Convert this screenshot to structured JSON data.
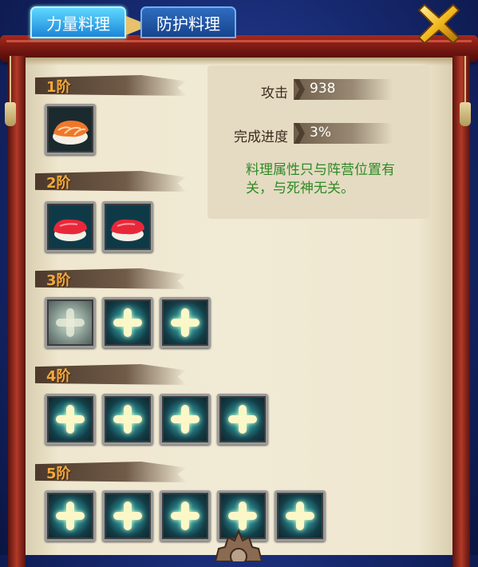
{
  "tabs": [
    {
      "label": "力量料理",
      "active": true
    },
    {
      "label": "防护料理",
      "active": false
    }
  ],
  "info": {
    "attack_label": "攻击",
    "attack_value": "938",
    "progress_label": "完成进度",
    "progress_value": "3%",
    "note": "料理属性只与阵营位置有关，与死神无关。"
  },
  "tiers": [
    {
      "label": "1阶",
      "slots": [
        "salmon-sushi"
      ]
    },
    {
      "label": "2阶",
      "slots": [
        "tuna-sushi",
        "tuna-sushi"
      ]
    },
    {
      "label": "3阶",
      "slots": [
        "add-selected",
        "add",
        "add"
      ]
    },
    {
      "label": "4阶",
      "slots": [
        "add",
        "add",
        "add",
        "add"
      ]
    },
    {
      "label": "5阶",
      "slots": [
        "add",
        "add",
        "add",
        "add",
        "add"
      ]
    }
  ],
  "colors": {
    "tier_label": "#f2a93c",
    "note_text": "#2f8a25",
    "active_tab": "#1b86d8",
    "scroll_red": "#a52a1e"
  },
  "icons": [
    "close-icon",
    "salmon-sushi-icon",
    "tuna-sushi-icon",
    "plus-icon"
  ]
}
